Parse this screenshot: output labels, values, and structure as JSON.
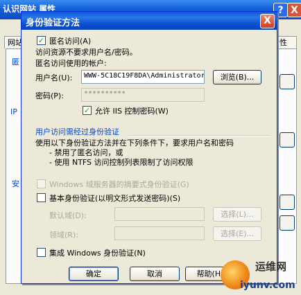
{
  "background_window": {
    "title": "认识网站 属性",
    "tabs": [
      "网站",
      "性"
    ],
    "side_labels": [
      "匿",
      "IP",
      "安"
    ],
    "help_glyph": "?",
    "close_glyph": "X"
  },
  "dialog": {
    "title": "身份验证方法",
    "close_glyph": "X",
    "anonymous": {
      "checkbox_label": "匿名访问(A)",
      "checked": true,
      "desc": "访问资源不要求用户名/密码。",
      "account_heading": "匿名访问使用的帐户:",
      "username_label": "用户名(U):",
      "username_value": "WWW-5C18C19F8DA\\Administrator",
      "browse_label": "浏览(B)...",
      "password_label": "密码(P):",
      "password_value": "**********",
      "allow_iis_label": "允许 IIS 控制密码(W)",
      "allow_iis_checked": true
    },
    "auth": {
      "heading": "用户访问需经过身份验证",
      "desc_line1": "使用以下身份验证方法并在下列条件下，要求用户名和密码",
      "desc_line2": "- 禁用了匿名访问，或",
      "desc_line3": "- 使用 NTFS 访问控制列表限制了访问权限",
      "windows_domain_label": "Windows 域服务器的摘要式身份验证(G)",
      "basic_label": "基本身份验证(以明文形式发送密码)(S)",
      "default_domain_label": "默认域(D):",
      "default_domain_value": "",
      "select1_label": "选择(L)...",
      "realm_label": "领域(R):",
      "realm_value": "",
      "select2_label": "选择(E)...",
      "integrated_label": "集成 Windows 身份验证(N)"
    },
    "buttons": {
      "ok": "确定",
      "cancel": "取消",
      "help": "帮助(H)"
    }
  },
  "watermark": {
    "cn": "运维网",
    "url": "iyunv.com"
  }
}
